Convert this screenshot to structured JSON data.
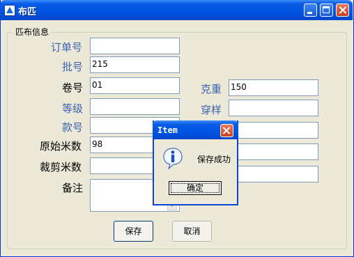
{
  "window": {
    "title": "布匹"
  },
  "group": {
    "label": "匹布信息"
  },
  "fields": {
    "order_no": {
      "label": "订单号",
      "value": ""
    },
    "batch_no": {
      "label": "批号",
      "value": "215"
    },
    "roll_no": {
      "label": "卷号",
      "value": "01"
    },
    "gram_weight": {
      "label": "克重",
      "value": "150"
    },
    "grade": {
      "label": "等级",
      "value": ""
    },
    "sample": {
      "label": "穿样",
      "value": ""
    },
    "style_no": {
      "label": "款号",
      "value": ""
    },
    "original_meters": {
      "label": "原始米数",
      "value": "98"
    },
    "cut_meters": {
      "label": "裁剪米数",
      "value": ""
    },
    "remark": {
      "label": "备注",
      "value": ""
    }
  },
  "buttons": {
    "save": "保存",
    "cancel": "取消"
  },
  "dialog": {
    "title": "Item",
    "message": "保存成功",
    "ok": "确定"
  }
}
